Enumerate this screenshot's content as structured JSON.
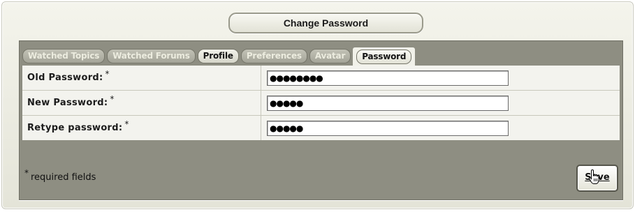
{
  "title": "Change Password",
  "tabs": [
    {
      "label": "Watched Topics"
    },
    {
      "label": "Watched Forums"
    },
    {
      "label": "Profile"
    },
    {
      "label": "Preferences"
    },
    {
      "label": "Avatar"
    },
    {
      "label": "Password"
    }
  ],
  "form": {
    "fields": [
      {
        "label": "Old Password:",
        "required_mark": "*",
        "masked_value": "●●●●●●●●"
      },
      {
        "label": "New Password:",
        "required_mark": "*",
        "masked_value": "●●●●●"
      },
      {
        "label": "Retype password:",
        "required_mark": "*",
        "masked_value": "●●●●●"
      }
    ]
  },
  "footer": {
    "required_mark": "*",
    "required_note": "required fields",
    "save_label": "Save"
  },
  "colors": {
    "panel_bg": "#8e8e82",
    "rows_bg": "#f3f3ee",
    "tab_inactive_text": "#ececdf"
  },
  "icons": {
    "cursor": "hand-pointer-icon"
  }
}
